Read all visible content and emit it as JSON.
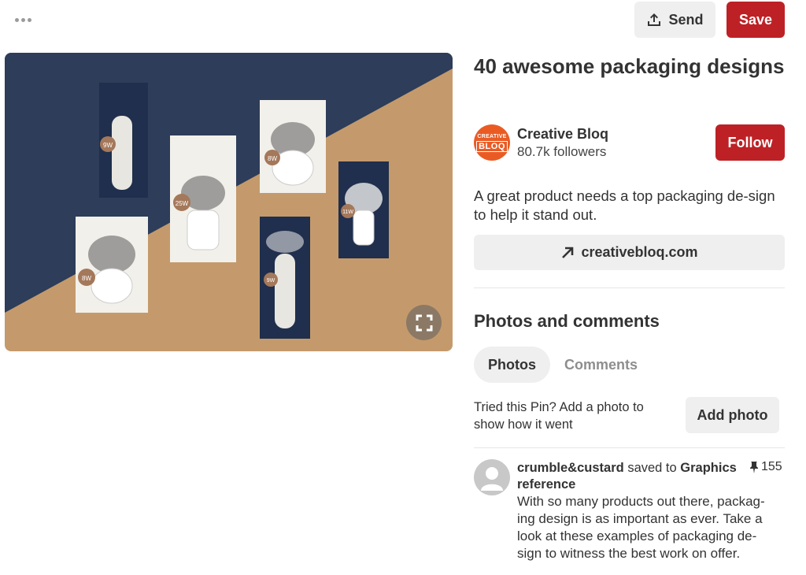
{
  "toolbar": {
    "send_label": "Send",
    "save_label": "Save"
  },
  "pin": {
    "title": "40 awesome packaging designs",
    "description": "A great product needs a top packaging de-sign to help it stand out.",
    "source_link": "creativebloq.com"
  },
  "creator": {
    "logo_line1": "CREATIVE",
    "logo_line2": "BLOQ",
    "name": "Creative Bloq",
    "followers": "80.7k followers",
    "follow_label": "Follow"
  },
  "photos_comments": {
    "title": "Photos and comments",
    "tab_photos": "Photos",
    "tab_comments": "Comments",
    "tried_text": "Tried this Pin? Add a photo to show how it went",
    "add_photo_label": "Add photo"
  },
  "activity": {
    "user": "crumble&custard",
    "saved_to": "saved to",
    "board": "Graphics reference",
    "pin_count": "155",
    "comment": "With so many products out there, packag-ing design is as important as ever. Take a look at these examples of packaging de-sign to witness the best work on offer."
  },
  "product_labels": [
    "9W",
    "25W",
    "8W",
    "11W",
    "8W",
    "9W"
  ],
  "colors": {
    "brand_red": "#bd2126",
    "button_gray": "#efefef",
    "image_navy": "#2d3d5a",
    "image_kraft": "#c49a6c"
  }
}
